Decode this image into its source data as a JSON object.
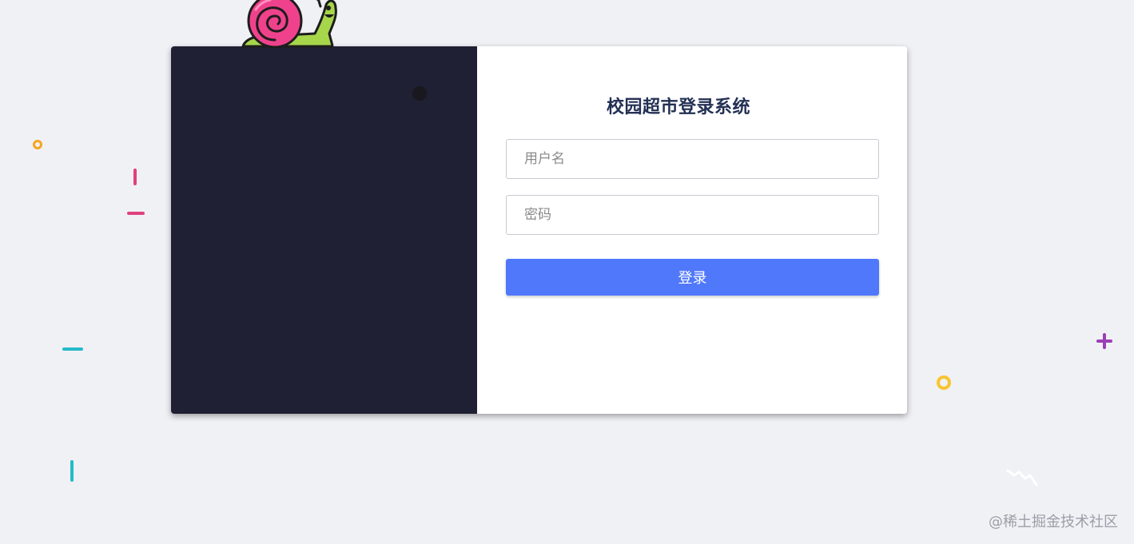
{
  "login": {
    "title": "校园超市登录系统",
    "username_placeholder": "用户名",
    "username_value": "",
    "password_placeholder": "密码",
    "password_value": "",
    "submit_label": "登录"
  },
  "watermark": "@稀土掘金技术社区",
  "colors": {
    "page_bg": "#f0f1f5",
    "panel_dark": "#1f2033",
    "title": "#233054",
    "button": "#5078fb",
    "snail_shell": "#f0428c",
    "snail_body": "#a7d64b"
  },
  "icons": [
    "snail-mascot-icon"
  ]
}
